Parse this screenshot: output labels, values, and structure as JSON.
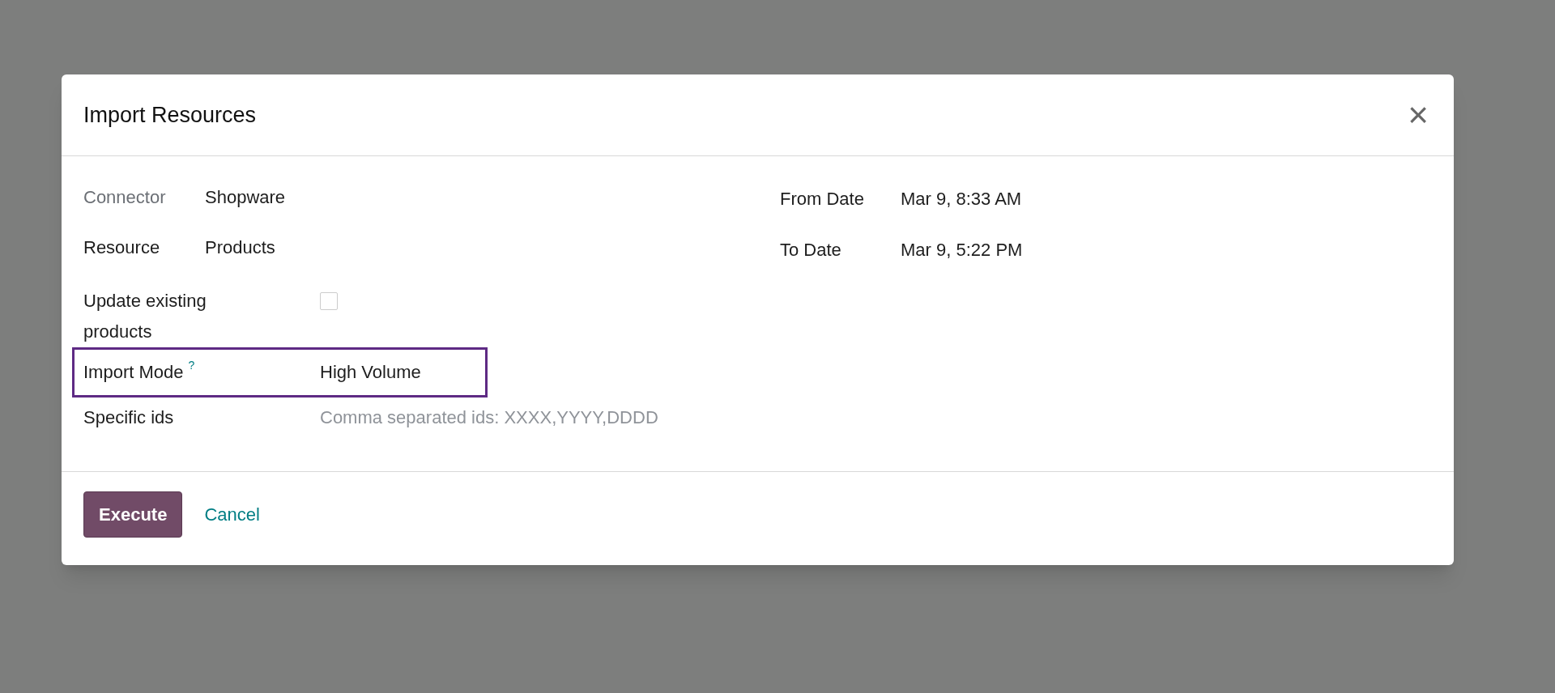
{
  "dialog": {
    "title": "Import Resources",
    "close_icon": "×"
  },
  "left_groups": [
    {
      "fields": [
        {
          "label": "Connector",
          "label_muted": true,
          "kind": "text",
          "value": "Shopware"
        },
        {
          "label": "Resource",
          "label_muted": false,
          "kind": "text",
          "value": "Products"
        }
      ]
    },
    {
      "fields": [
        {
          "label": "Update existing products",
          "label_muted": false,
          "kind": "checkbox",
          "checked": false
        },
        {
          "label": "Import Mode",
          "label_muted": false,
          "kind": "text",
          "value": "High Volume",
          "help": "?",
          "highlighted": true
        },
        {
          "label": "Specific ids",
          "label_muted": false,
          "kind": "input",
          "placeholder": "Comma separated ids: XXXX,YYYY,DDDD"
        }
      ]
    }
  ],
  "right_fields": [
    {
      "label": "From Date",
      "value": "Mar 9, 8:33 AM"
    },
    {
      "label": "To Date",
      "value": "Mar 9, 5:22 PM"
    }
  ],
  "buttons": [
    {
      "label": "Execute",
      "kind": "primary"
    },
    {
      "label": "Cancel",
      "kind": "link"
    }
  ]
}
